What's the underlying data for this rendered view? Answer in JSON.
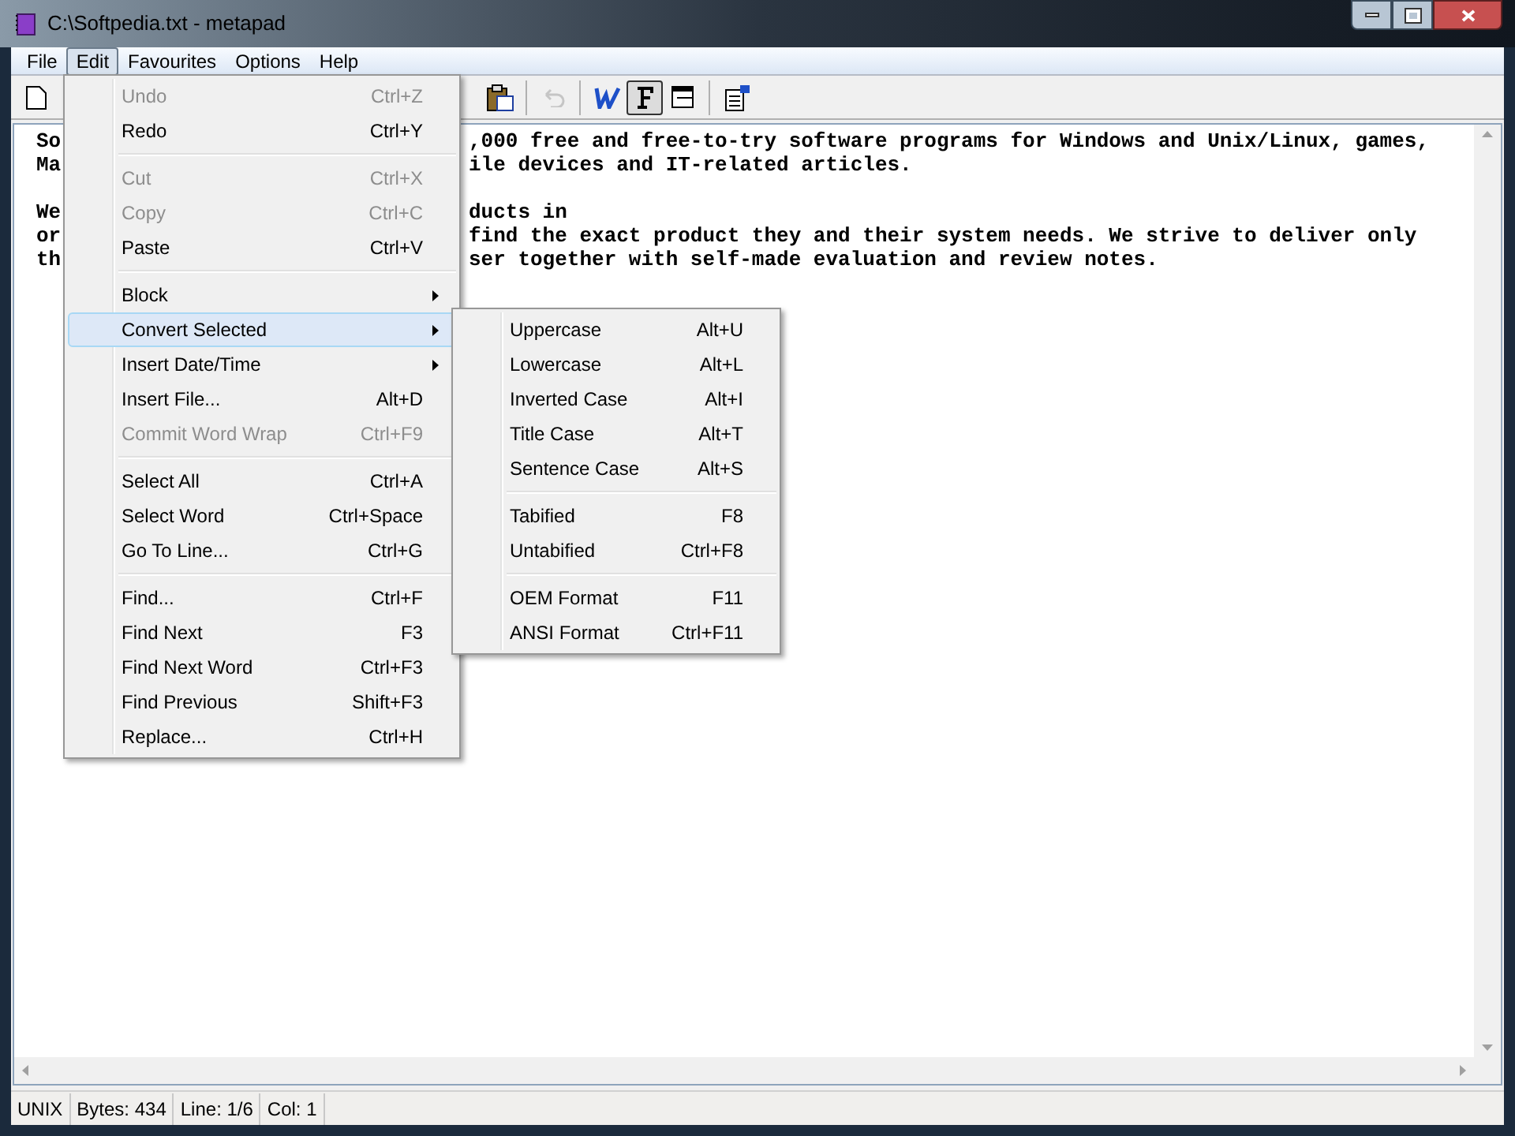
{
  "window": {
    "title": "C:\\Softpedia.txt - metapad"
  },
  "menu_bar": [
    {
      "label": "File",
      "selected": false
    },
    {
      "label": "Edit",
      "selected": true
    },
    {
      "label": "Favourites",
      "selected": false
    },
    {
      "label": "Options",
      "selected": false
    },
    {
      "label": "Help",
      "selected": false
    }
  ],
  "toolbar": [
    {
      "kind": "new",
      "pressed": false,
      "disabled": false
    },
    {
      "kind": "paste",
      "pressed": false,
      "disabled": false
    },
    {
      "kind": "undo",
      "pressed": false,
      "disabled": true
    },
    {
      "kind": "wordwrap",
      "pressed": false,
      "disabled": false
    },
    {
      "kind": "font",
      "pressed": true,
      "disabled": false
    },
    {
      "kind": "window",
      "pressed": false,
      "disabled": false
    },
    {
      "kind": "settings",
      "pressed": false,
      "disabled": false
    }
  ],
  "editor_lines": [
    {
      "kind": "text",
      "left": "So",
      "right": ",000 free and free-to-try software programs for Windows and Unix/Linux, games,"
    },
    {
      "kind": "text",
      "left": "Ma",
      "right": "ile devices and IT-related articles."
    },
    {
      "kind": "blank"
    },
    {
      "kind": "text",
      "left": "We",
      "right": "ducts in"
    },
    {
      "kind": "text",
      "left": "or",
      "right": "find the exact product they and their system needs. We strive to deliver only"
    },
    {
      "kind": "text",
      "left": "th",
      "right": "ser together with self-made evaluation and review notes."
    }
  ],
  "edit_menu": [
    {
      "kind": "item",
      "label": "Undo",
      "shortcut": "Ctrl+Z",
      "disabled": true,
      "selected": false
    },
    {
      "kind": "item",
      "label": "Redo",
      "shortcut": "Ctrl+Y",
      "disabled": false,
      "selected": false
    },
    {
      "kind": "separator"
    },
    {
      "kind": "item",
      "label": "Cut",
      "shortcut": "Ctrl+X",
      "disabled": true,
      "selected": false
    },
    {
      "kind": "item",
      "label": "Copy",
      "shortcut": "Ctrl+C",
      "disabled": true,
      "selected": false
    },
    {
      "kind": "item",
      "label": "Paste",
      "shortcut": "Ctrl+V",
      "disabled": false,
      "selected": false
    },
    {
      "kind": "separator"
    },
    {
      "kind": "submenu",
      "label": "Block",
      "disabled": false,
      "selected": false
    },
    {
      "kind": "submenu",
      "label": "Convert Selected",
      "disabled": false,
      "selected": true
    },
    {
      "kind": "submenu",
      "label": "Insert Date/Time",
      "disabled": false,
      "selected": false
    },
    {
      "kind": "item",
      "label": "Insert File...",
      "shortcut": "Alt+D",
      "disabled": false,
      "selected": false
    },
    {
      "kind": "item",
      "label": "Commit Word Wrap",
      "shortcut": "Ctrl+F9",
      "disabled": true,
      "selected": false
    },
    {
      "kind": "separator"
    },
    {
      "kind": "item",
      "label": "Select All",
      "shortcut": "Ctrl+A",
      "disabled": false,
      "selected": false
    },
    {
      "kind": "item",
      "label": "Select Word",
      "shortcut": "Ctrl+Space",
      "disabled": false,
      "selected": false
    },
    {
      "kind": "item",
      "label": "Go To Line...",
      "shortcut": "Ctrl+G",
      "disabled": false,
      "selected": false
    },
    {
      "kind": "separator"
    },
    {
      "kind": "item",
      "label": "Find...",
      "shortcut": "Ctrl+F",
      "disabled": false,
      "selected": false
    },
    {
      "kind": "item",
      "label": "Find Next",
      "shortcut": "F3",
      "disabled": false,
      "selected": false
    },
    {
      "kind": "item",
      "label": "Find Next Word",
      "shortcut": "Ctrl+F3",
      "disabled": false,
      "selected": false
    },
    {
      "kind": "item",
      "label": "Find Previous",
      "shortcut": "Shift+F3",
      "disabled": false,
      "selected": false
    },
    {
      "kind": "item",
      "label": "Replace...",
      "shortcut": "Ctrl+H",
      "disabled": false,
      "selected": false
    }
  ],
  "convert_submenu": [
    {
      "kind": "item",
      "label": "Uppercase",
      "shortcut": "Alt+U"
    },
    {
      "kind": "item",
      "label": "Lowercase",
      "shortcut": "Alt+L"
    },
    {
      "kind": "item",
      "label": "Inverted Case",
      "shortcut": "Alt+I"
    },
    {
      "kind": "item",
      "label": "Title Case",
      "shortcut": "Alt+T"
    },
    {
      "kind": "item",
      "label": "Sentence Case",
      "shortcut": "Alt+S"
    },
    {
      "kind": "separator"
    },
    {
      "kind": "item",
      "label": "Tabified",
      "shortcut": "F8"
    },
    {
      "kind": "item",
      "label": "Untabified",
      "shortcut": "Ctrl+F8"
    },
    {
      "kind": "separator"
    },
    {
      "kind": "item",
      "label": "OEM Format",
      "shortcut": "F11"
    },
    {
      "kind": "item",
      "label": "ANSI Format",
      "shortcut": "Ctrl+F11"
    }
  ],
  "status_bar": [
    "UNIX",
    "Bytes: 434",
    "Line: 1/6",
    "Col: 1"
  ]
}
